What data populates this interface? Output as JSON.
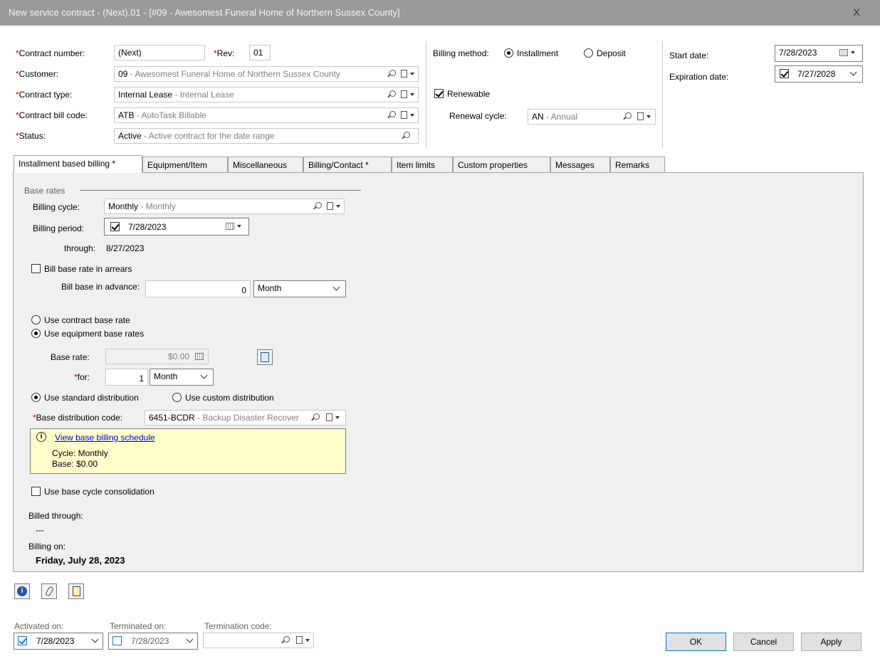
{
  "window": {
    "title": "New service contract - (Next).01 - [#09 - Awesomest Funeral Home of Northern Sussex County]",
    "close_label": "X"
  },
  "header": {
    "contract_number_label": "Contract number:",
    "contract_number_value": "(Next)",
    "rev_label": "Rev:",
    "rev_value": "01",
    "customer_label": "Customer:",
    "customer_code": "09",
    "customer_desc": " - Awesomest Funeral Home of Northern Sussex County",
    "contract_type_label": "Contract type:",
    "contract_type_code": "Internal Lease",
    "contract_type_desc": " - Internal Lease",
    "bill_code_label": "Contract bill code:",
    "bill_code_code": "ATB",
    "bill_code_desc": " - AutoTask Billable",
    "status_label": "Status:",
    "status_code": "Active",
    "status_desc": " - Active contract for the date range",
    "billing_method_label": "Billing method:",
    "billing_method_installment": "Installment",
    "billing_method_deposit": "Deposit",
    "renewable_label": "Renewable",
    "renewal_cycle_label": "Renewal cycle:",
    "renewal_cycle_code": "AN",
    "renewal_cycle_desc": " - Annual",
    "start_date_label": "Start date:",
    "start_date_value": "7/28/2023",
    "expiration_date_label": "Expiration date:",
    "expiration_date_value": "7/27/2028"
  },
  "tabs": [
    {
      "label": "Installment based billing *"
    },
    {
      "label": "Equipment/Item"
    },
    {
      "label": "Miscellaneous"
    },
    {
      "label": "Billing/Contact *"
    },
    {
      "label": "Item limits"
    },
    {
      "label": "Custom properties"
    },
    {
      "label": "Messages"
    },
    {
      "label": "Remarks"
    }
  ],
  "installment": {
    "section_title": "Base rates",
    "billing_cycle_label": "Billing cycle:",
    "billing_cycle_code": "Monthly",
    "billing_cycle_desc": " - Monthly",
    "billing_period_label": "Billing period:",
    "billing_period_value": "7/28/2023",
    "through_label": "through:",
    "through_value": "8/27/2023",
    "arrears_label": "Bill base rate in arrears",
    "advance_label": "Bill base in advance:",
    "advance_value": "0",
    "advance_unit": "Month",
    "use_contract_rate": "Use contract base rate",
    "use_equipment_rates": "Use equipment base rates",
    "base_rate_label": "Base rate:",
    "base_rate_value": "$0.00",
    "for_label": "for:",
    "for_value": "1",
    "for_unit": "Month",
    "standard_dist": "Use standard distribution",
    "custom_dist": "Use custom distribution",
    "dist_code_label": "Base distribution code:",
    "dist_code_code": "6451-BCDR",
    "dist_code_desc": " - Backup Disaster Recover",
    "schedule_link": "View base billing schedule",
    "cycle_info": "Cycle: Monthly",
    "base_info": "Base: $0.00",
    "consolidation_label": "Use base cycle consolidation",
    "billed_through_label": "Billed through:",
    "billed_through_value": "---",
    "billing_on_label": "Billing on:",
    "billing_on_value": "Friday, July 28, 2023"
  },
  "footer": {
    "activated_label": "Activated on:",
    "activated_value": "7/28/2023",
    "terminated_label": "Terminated on:",
    "terminated_value": "7/28/2023",
    "termination_code_label": "Termination code:",
    "ok": "OK",
    "cancel": "Cancel",
    "apply": "Apply"
  }
}
